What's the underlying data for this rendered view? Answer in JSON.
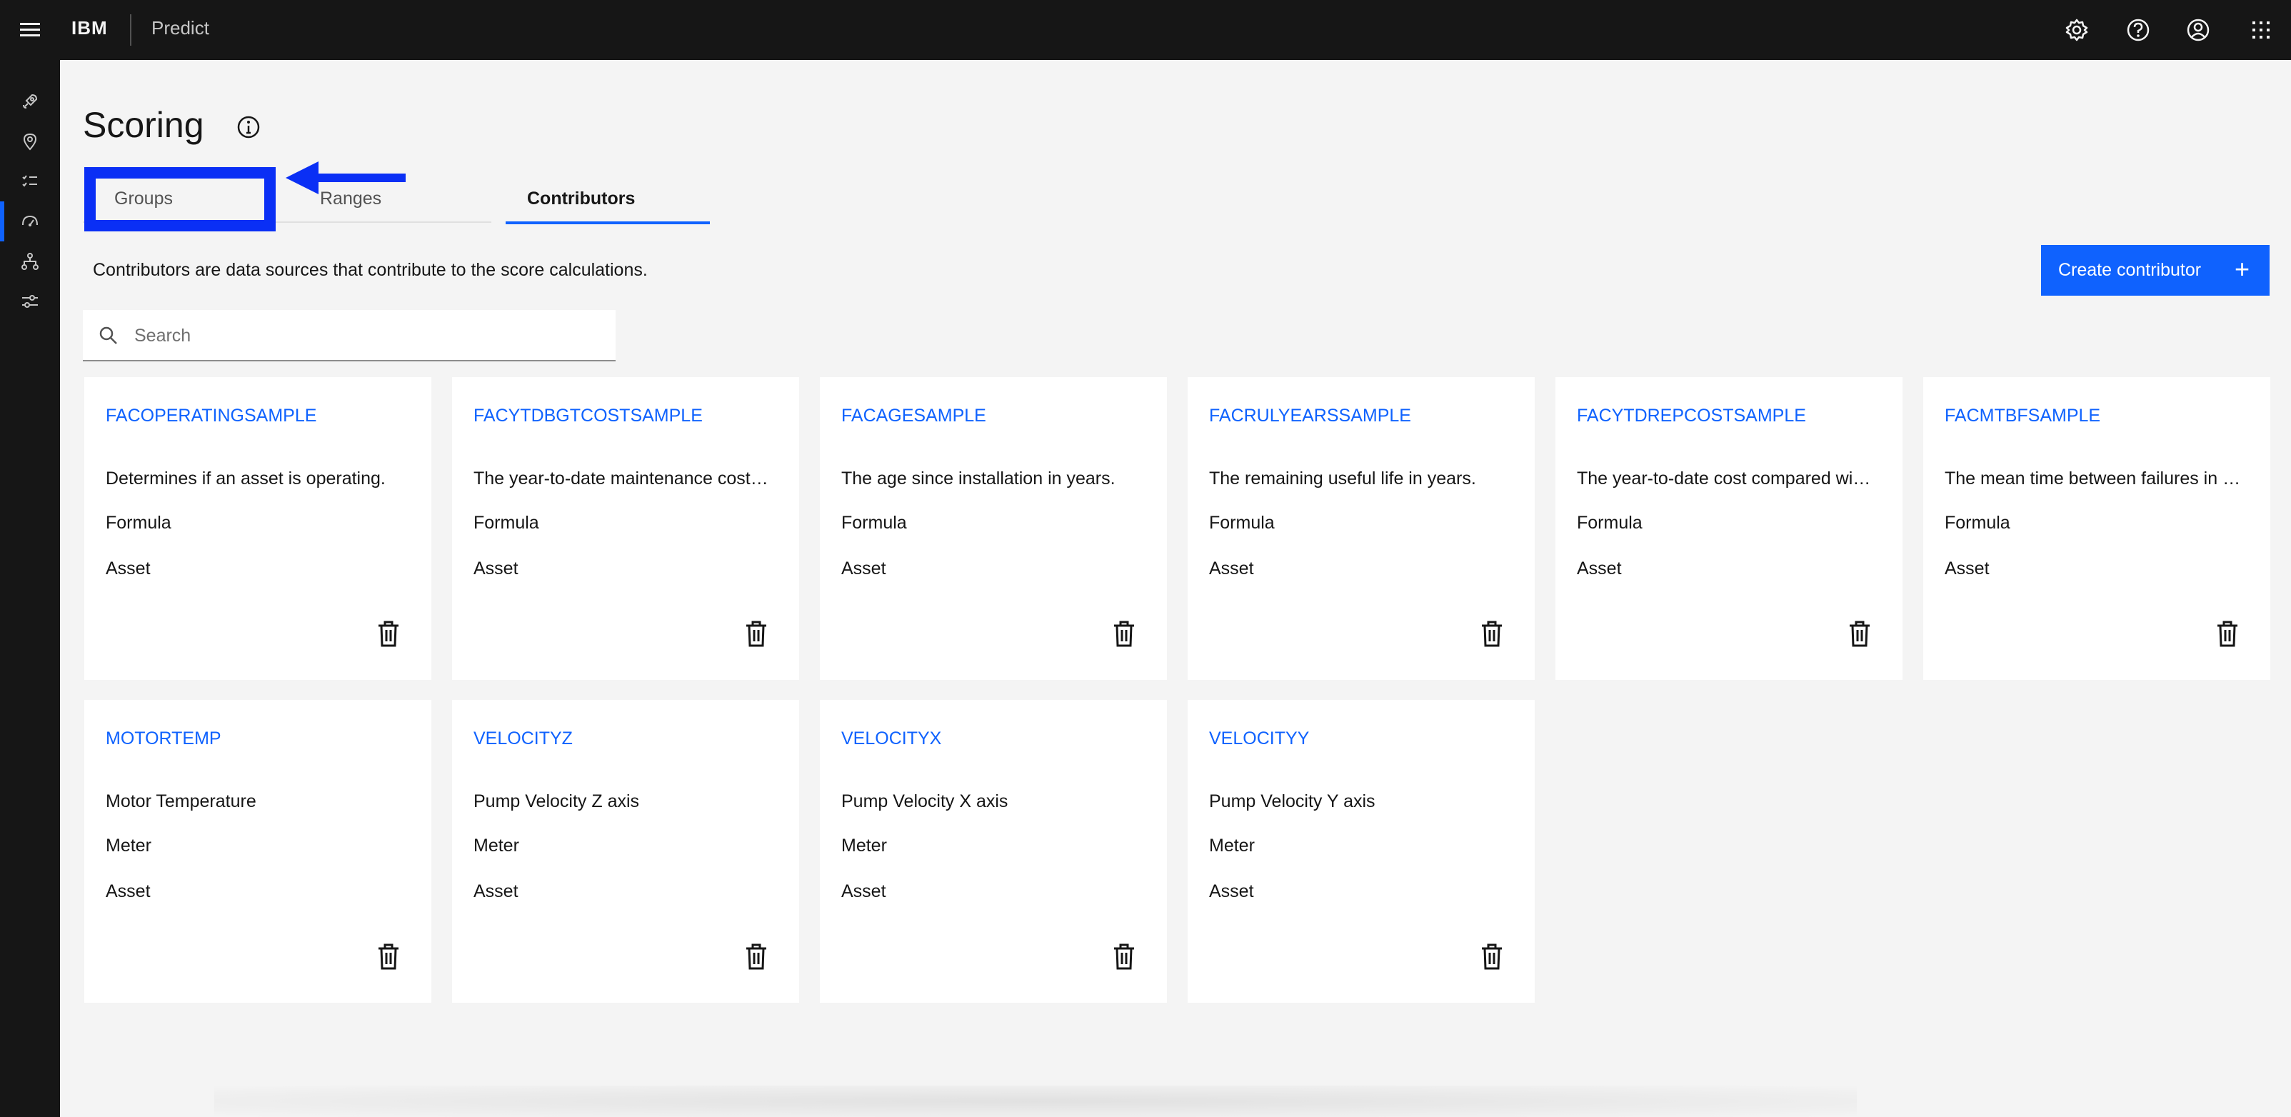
{
  "header": {
    "brand": "IBM",
    "product": "Predict",
    "icons": [
      "settings-icon",
      "help-icon",
      "user-avatar-icon",
      "app-switcher-icon"
    ]
  },
  "sidenav": {
    "items": [
      "rocket-icon",
      "location-icon",
      "checklist-icon",
      "dashboard-icon",
      "hierarchy-icon",
      "settings-adjust-icon"
    ],
    "active_index": 3
  },
  "page": {
    "title": "Scoring",
    "tabs": [
      {
        "label": "Groups"
      },
      {
        "label": "Ranges"
      },
      {
        "label": "Contributors"
      }
    ],
    "active_tab": "Contributors",
    "description": "Contributors are data sources that contribute to the score calculations.",
    "create_button_label": "Create contributor",
    "create_button_icon": "+",
    "search_placeholder": "Search"
  },
  "contributors": [
    {
      "name": "FACOPERATINGSAMPLE",
      "description": "Determines if an asset is operating.",
      "type": "Formula",
      "scope": "Asset"
    },
    {
      "name": "FACYTDBGTCOSTSAMPLE",
      "description": "The year-to-date maintenance cost…",
      "type": "Formula",
      "scope": "Asset"
    },
    {
      "name": "FACAGESAMPLE",
      "description": "The age since installation in years.",
      "type": "Formula",
      "scope": "Asset"
    },
    {
      "name": "FACRULYEARSSAMPLE",
      "description": "The remaining useful life in years.",
      "type": "Formula",
      "scope": "Asset"
    },
    {
      "name": "FACYTDREPCOSTSAMPLE",
      "description": "The year-to-date cost compared wi…",
      "type": "Formula",
      "scope": "Asset"
    },
    {
      "name": "FACMTBFSAMPLE",
      "description": "The mean time between failures in …",
      "type": "Formula",
      "scope": "Asset"
    },
    {
      "name": "MOTORTEMP",
      "description": "Motor Temperature",
      "type": "Meter",
      "scope": "Asset"
    },
    {
      "name": "VELOCITYZ",
      "description": "Pump Velocity Z axis",
      "type": "Meter",
      "scope": "Asset"
    },
    {
      "name": "VELOCITYX",
      "description": "Pump Velocity X axis",
      "type": "Meter",
      "scope": "Asset"
    },
    {
      "name": "VELOCITYY",
      "description": "Pump Velocity Y axis",
      "type": "Meter",
      "scope": "Asset"
    }
  ],
  "colors": {
    "header_bg": "#161616",
    "accent": "#0f62fe",
    "annotation": "#0a2ff5",
    "page_bg": "#f4f4f4"
  }
}
